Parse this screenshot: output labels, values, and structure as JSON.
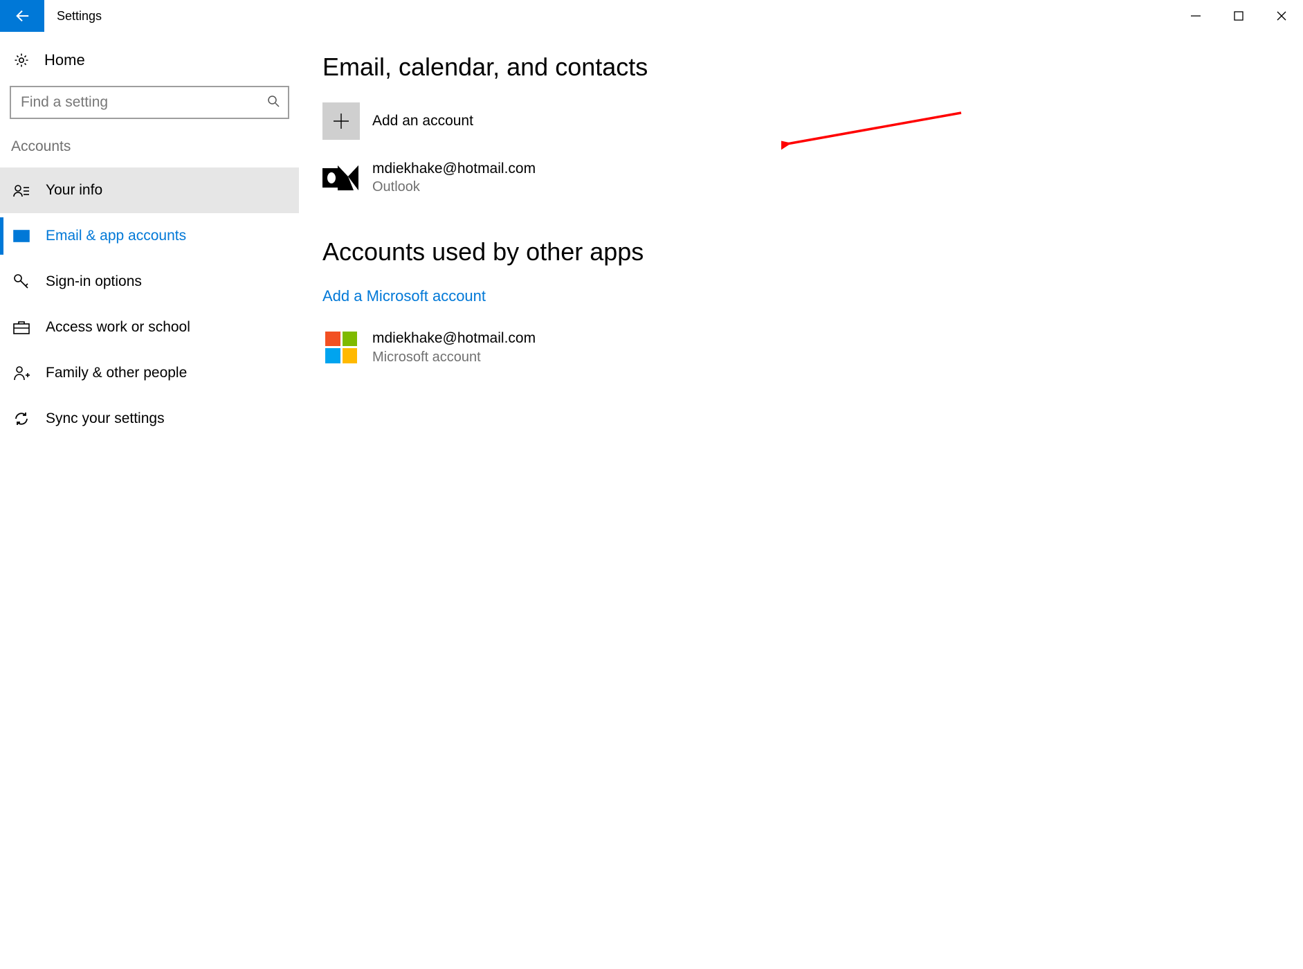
{
  "window": {
    "title": "Settings"
  },
  "sidebar": {
    "home": "Home",
    "search_placeholder": "Find a setting",
    "category": "Accounts",
    "items": [
      {
        "label": "Your info"
      },
      {
        "label": "Email & app accounts"
      },
      {
        "label": "Sign-in options"
      },
      {
        "label": "Access work or school"
      },
      {
        "label": "Family & other people"
      },
      {
        "label": "Sync your settings"
      }
    ]
  },
  "main": {
    "section1_title": "Email, calendar, and contacts",
    "add_account": "Add an account",
    "account1": {
      "email": "mdiekhake@hotmail.com",
      "provider": "Outlook"
    },
    "section2_title": "Accounts used by other apps",
    "add_ms_link": "Add a Microsoft account",
    "account2": {
      "email": "mdiekhake@hotmail.com",
      "provider": "Microsoft account"
    }
  }
}
